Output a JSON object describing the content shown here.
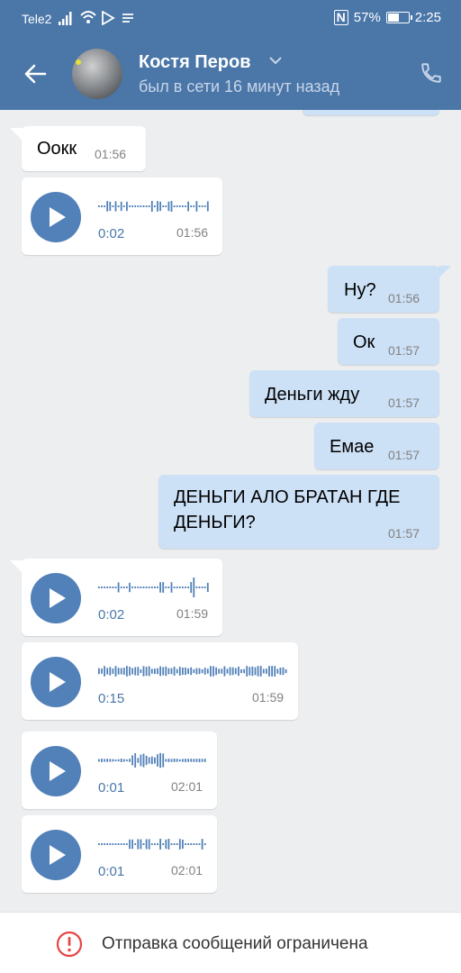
{
  "status_bar": {
    "carrier": "Tele2",
    "nfc": "N",
    "battery": "57%",
    "battery_level": 0.57,
    "time": "2:25"
  },
  "header": {
    "contact_name": "Костя Перов",
    "last_seen": "был в сети 16 минут назад"
  },
  "messages": [
    {
      "direction": "in",
      "type": "text",
      "text": "Оокк",
      "time": "01:56"
    },
    {
      "direction": "in",
      "type": "voice",
      "duration": "0:02",
      "time": "01:56"
    },
    {
      "direction": "out",
      "type": "text",
      "text": "Ну?",
      "time": "01:56"
    },
    {
      "direction": "out",
      "type": "text",
      "text": "Ок",
      "time": "01:57"
    },
    {
      "direction": "out",
      "type": "text",
      "text": "Деньги жду",
      "time": "01:57"
    },
    {
      "direction": "out",
      "type": "text",
      "text": "Емае",
      "time": "01:57"
    },
    {
      "direction": "out",
      "type": "text",
      "text_line1": "ДЕНЬГИ АЛО БРАТАН ГДЕ",
      "text_line2": "ДЕНЬГИ?",
      "time": "01:57"
    },
    {
      "direction": "in",
      "type": "voice",
      "duration": "0:02",
      "time": "01:59"
    },
    {
      "direction": "in",
      "type": "voice",
      "duration": "0:15",
      "time": "01:59"
    },
    {
      "direction": "in",
      "type": "voice",
      "duration": "0:01",
      "time": "02:01"
    },
    {
      "direction": "in",
      "type": "voice",
      "duration": "0:01",
      "time": "02:01"
    }
  ],
  "footer": {
    "notice": "Отправка сообщений ограничена"
  },
  "colors": {
    "header": "#4a76a8",
    "background": "#edeef0",
    "outgoing": "#cce0f6",
    "play_button": "#5181b8",
    "time_text": "#828282",
    "warning": "#e64646"
  },
  "icons": [
    "back-arrow-icon",
    "chevron-down-icon",
    "phone-icon",
    "play-icon",
    "warning-icon",
    "signal-icon",
    "wifi-icon",
    "battery-icon"
  ]
}
